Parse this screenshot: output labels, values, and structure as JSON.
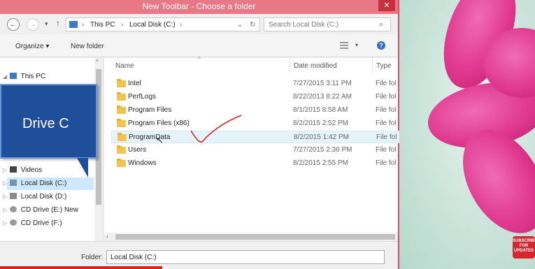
{
  "window": {
    "title": "New Toolbar - Choose a folder",
    "close_glyph": "✕"
  },
  "address": {
    "path": [
      "This PC",
      "Local Disk (C:)"
    ],
    "separator": "›",
    "search_placeholder": "Search Local Disk (C:)"
  },
  "toolbar": {
    "organize": "Organize ▾",
    "new_folder": "New folder"
  },
  "navpane": {
    "this_pc": "This PC",
    "items": [
      {
        "label": "Videos",
        "icon": "video-folder-icon"
      },
      {
        "label": "Local Disk (C:)",
        "icon": "drive-icon",
        "selected": true
      },
      {
        "label": "Local Disk (D:)",
        "icon": "drive-icon"
      },
      {
        "label": "CD Drive (E:) New",
        "icon": "cd-drive-icon"
      },
      {
        "label": "CD Drive (F:)",
        "icon": "cd-drive-icon"
      }
    ]
  },
  "callout": {
    "text": "Drive C"
  },
  "columns": {
    "name": "Name",
    "date": "Date modified",
    "type": "Type"
  },
  "files": [
    {
      "name": "Intel",
      "date": "7/27/2015 3:11 PM",
      "type": "File fol"
    },
    {
      "name": "PerfLogs",
      "date": "8/22/2013 8:22 AM",
      "type": "File fol"
    },
    {
      "name": "Program Files",
      "date": "8/1/2015 8:58 AM",
      "type": "File fol"
    },
    {
      "name": "Program Files (x86)",
      "date": "8/2/2015 2:52 PM",
      "type": "File fol"
    },
    {
      "name": "ProgramData",
      "date": "8/2/2015 1:42 PM",
      "type": "File fol"
    },
    {
      "name": "Users",
      "date": "7/27/2015 2:36 PM",
      "type": "File fol"
    },
    {
      "name": "Windows",
      "date": "8/2/2015 2:55 PM",
      "type": "File fol"
    }
  ],
  "bottom": {
    "folder_label": "Folder:",
    "folder_value": "Local Disk (C:)"
  },
  "overlay": {
    "subscribe": "SUBSCRIBE FOR UPDATES"
  },
  "colors": {
    "title_bar": "#e87886",
    "accent_red": "#e0201b",
    "callout_blue": "#1f4f9a",
    "annotation_red": "#e02020"
  }
}
